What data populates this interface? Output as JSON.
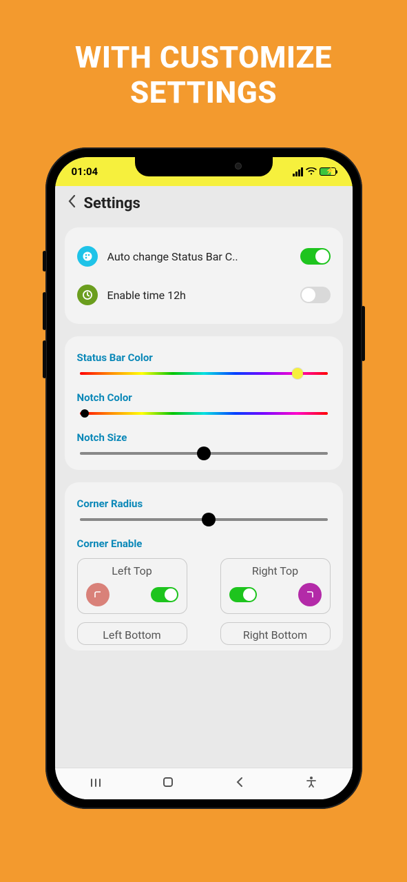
{
  "promo": {
    "line1": "WITH CUSTOMIZE",
    "line2": "SETTINGS"
  },
  "status_bar": {
    "time": "01:04"
  },
  "header": {
    "title": "Settings"
  },
  "card_toggles": {
    "auto_color": {
      "label": "Auto change Status Bar C..",
      "on": true
    },
    "time_12h": {
      "label": "Enable time 12h",
      "on": false
    }
  },
  "card_sliders": {
    "status_bar_color": {
      "label": "Status Bar Color",
      "value_pct": 88
    },
    "notch_color": {
      "label": "Notch Color",
      "value_pct": 2
    },
    "notch_size": {
      "label": "Notch Size",
      "value_pct": 50
    }
  },
  "card_corners": {
    "radius_label": "Corner Radius",
    "radius_value_pct": 52,
    "enable_label": "Corner Enable",
    "boxes": {
      "lt": {
        "title": "Left Top",
        "on": true
      },
      "rt": {
        "title": "Right Top",
        "on": true
      },
      "lb": {
        "title": "Left Bottom"
      },
      "rb": {
        "title": "Right Bottom"
      }
    }
  }
}
